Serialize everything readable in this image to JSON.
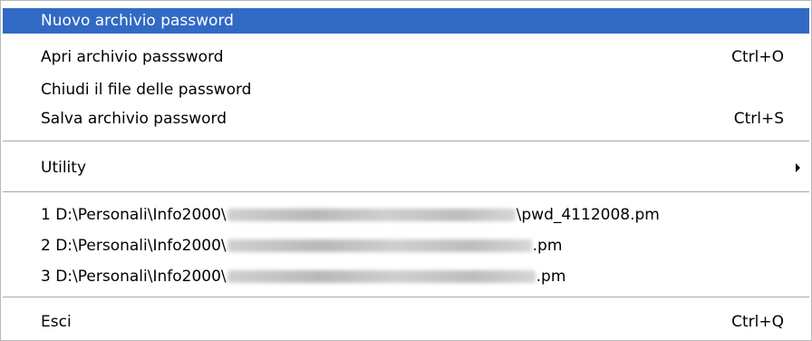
{
  "menu": {
    "new_file": {
      "label": "Nuovo archivio password"
    },
    "open_file": {
      "label": "Apri archivio passsword",
      "shortcut": "Ctrl+O"
    },
    "close_file": {
      "label": "Chiudi il file delle password"
    },
    "save_file": {
      "label": "Salva archivio password",
      "shortcut": "Ctrl+S"
    },
    "utility": {
      "label": "Utility",
      "icon": "submenu-arrow-icon"
    },
    "recent": [
      {
        "prefix": "1 D:\\Personali\\Info2000\\",
        "suffix": "\\pwd_4112008.pm"
      },
      {
        "prefix": "2 D:\\Personali\\Info2000\\",
        "suffix": ".pm"
      },
      {
        "prefix": "3 D:\\Personali\\Info2000\\",
        "suffix": ".pm"
      }
    ],
    "exit": {
      "label": "Esci",
      "shortcut": "Ctrl+Q"
    }
  },
  "colors": {
    "highlight_bg": "#316ac5",
    "highlight_text": "#ffffff",
    "separator": "#aca899",
    "border": "#b9b9b9"
  }
}
